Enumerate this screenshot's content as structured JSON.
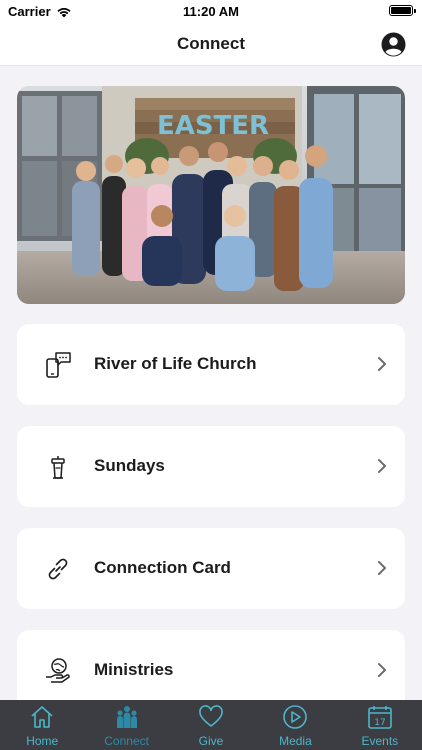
{
  "status_bar": {
    "carrier": "Carrier",
    "time": "11:20 AM",
    "wifi_icon": "wifi-icon",
    "battery_icon": "battery-full-icon"
  },
  "nav": {
    "title": "Connect",
    "profile_icon": "user-circle-icon"
  },
  "hero": {
    "sign_text": "EASTER"
  },
  "cards": [
    {
      "label": "River of Life Church",
      "icon": "phone-chat-icon"
    },
    {
      "label": "Sundays",
      "icon": "pulpit-icon"
    },
    {
      "label": "Connection Card",
      "icon": "link-icon"
    },
    {
      "label": "Ministries",
      "icon": "globe-hand-icon"
    }
  ],
  "tabs": [
    {
      "label": "Home",
      "icon": "home-icon",
      "active": false
    },
    {
      "label": "Connect",
      "icon": "people-icon",
      "active": true
    },
    {
      "label": "Give",
      "icon": "heart-icon",
      "active": false
    },
    {
      "label": "Media",
      "icon": "play-circle-icon",
      "active": false
    },
    {
      "label": "Events",
      "icon": "calendar-icon",
      "active": false,
      "badge": "17"
    }
  ],
  "colors": {
    "accent": "#4db6c9",
    "accent_active": "#2c8aa6",
    "tab_bar": "#3b3d42",
    "background": "#f2f2f7",
    "card": "#ffffff"
  }
}
